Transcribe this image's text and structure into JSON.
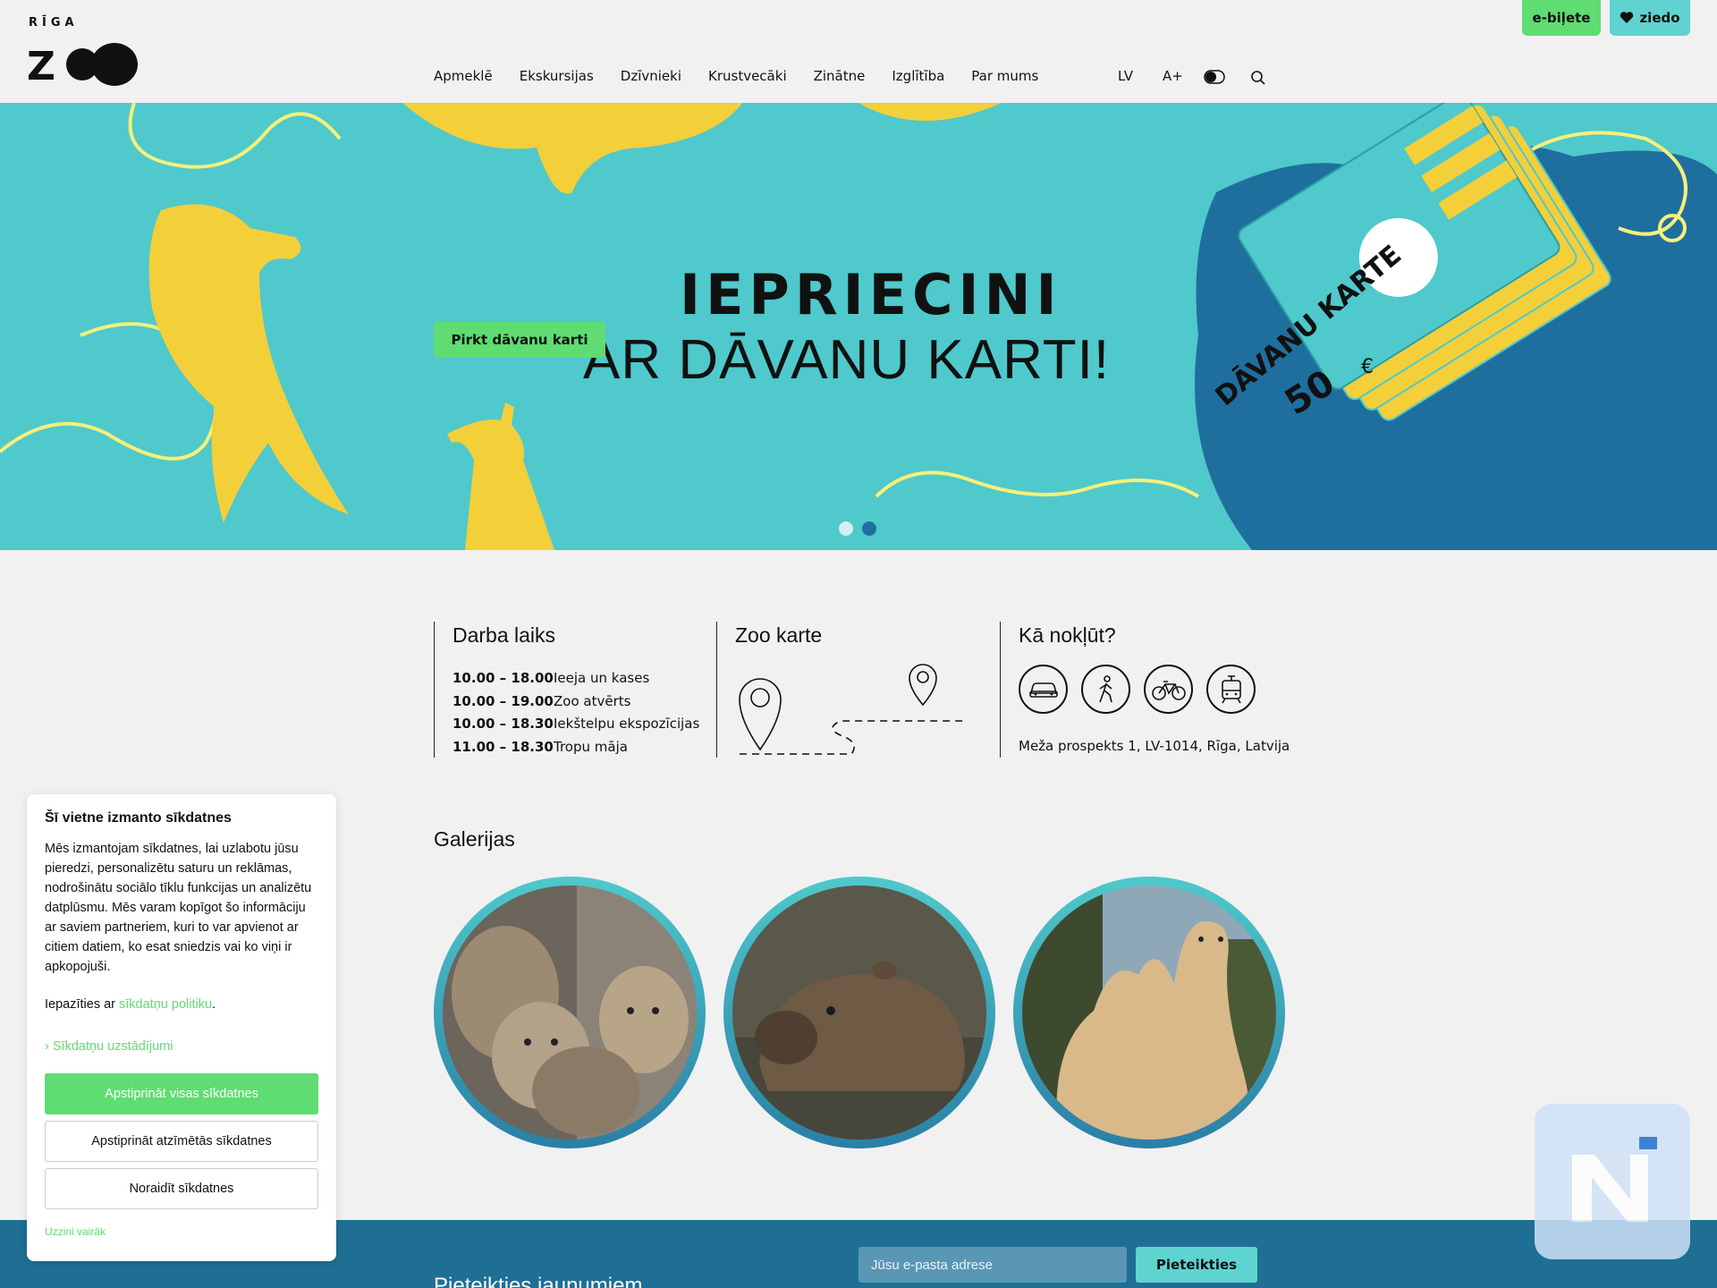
{
  "logo": {
    "top_text": "RĪGA",
    "mark_text": "ZOO"
  },
  "top_buttons": {
    "eticket": "e-biļete",
    "donate": "ziedo"
  },
  "nav": {
    "items": [
      "Apmeklē",
      "Ekskursijas",
      "Dzīvnieki",
      "Krustvecāki",
      "Zinātne",
      "Izglītība",
      "Par mums"
    ],
    "lang": "LV",
    "font_size": "A+"
  },
  "hero": {
    "title": "IEPRIECINI",
    "subtitle": "AR DĀVANU KARTI!",
    "button": "Pirkt dāvanu karti",
    "card_title": "DĀVANU KARTE",
    "card_value": "50",
    "card_currency": "€",
    "slides_count": 2,
    "active_slide": 2
  },
  "info": {
    "hours_title": "Darba laiks",
    "hours": [
      {
        "time": "10.00 – 18.00",
        "label": "Ieeja un kases"
      },
      {
        "time": "10.00 – 19.00",
        "label": "Zoo atvērts"
      },
      {
        "time": "10.00 – 18.30",
        "label": "Iekštelpu ekspozīcijas"
      },
      {
        "time": "11.00 – 18.30",
        "label": "Tropu māja"
      }
    ],
    "map_title": "Zoo karte",
    "reach_title": "Kā nokļūt?",
    "transport_icons": [
      "car-icon",
      "walk-icon",
      "bike-icon",
      "tram-icon"
    ],
    "address": "Meža prospekts 1, LV-1014, Rīga, Latvija"
  },
  "gallery": {
    "title": "Galerijas",
    "items": [
      "lynx",
      "capybara",
      "camel"
    ]
  },
  "newsletter": {
    "title": "Pieteikties jaunumiem",
    "placeholder": "Jūsu e-pasta adrese",
    "button": "Pieteikties"
  },
  "cookie": {
    "title": "Šī vietne izmanto sīkdatnes",
    "text": "Mēs izmantojam sīkdatnes, lai uzlabotu jūsu pieredzi, personalizētu saturu un reklāmas, nodrošinātu sociālo tīklu funkcijas un analizētu datplūsmu. Mēs varam kopīgot šo informāciju ar saviem partneriem, kuri to var apvienot ar citiem datiem, ko esat sniedzis vai ko viņi ir apkopojuši.",
    "policy_prefix": "Iepazīties ar",
    "policy_link": "sīkdatņu politiku",
    "policy_suffix": ".",
    "settings": "Sīkdatņu uzstādījumi",
    "accept_all": "Apstiprināt visas sīkdatnes",
    "accept_selected": "Apstiprināt atzīmētās sīkdatnes",
    "reject": "Noraidīt sīkdatnes",
    "learn_more": "Uzzini vairāk"
  },
  "colors": {
    "accent_green": "#5fdc72",
    "accent_teal": "#5fd3d0",
    "hero_bg": "#4fc9cb",
    "hero_yellow": "#f3cf3a",
    "footer_blue": "#1f6f94"
  }
}
